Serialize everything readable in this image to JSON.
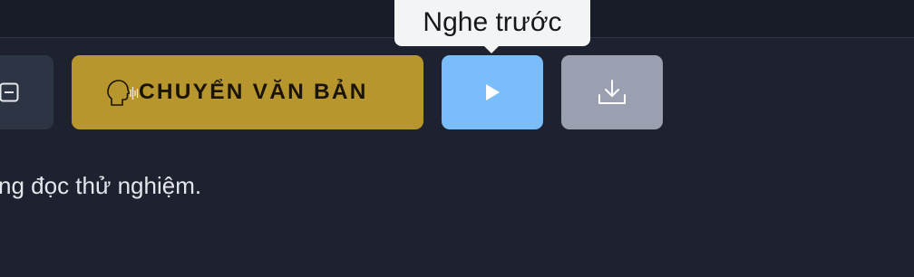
{
  "toolbar": {
    "convert_label": "CHUYỂN VĂN BẢN",
    "tooltip": "Nghe trước"
  },
  "content": {
    "text": "ng đọc thử nghiệm."
  },
  "icons": {
    "left": "box-arrow-icon",
    "convert": "speaking-head-icon",
    "play": "play-icon",
    "download": "download-icon"
  },
  "colors": {
    "background": "#1e2230",
    "convert_button": "#b8962e",
    "play_button": "#79bdfb",
    "download_button": "#9aa0b0",
    "tooltip_bg": "#f3f4f6"
  }
}
